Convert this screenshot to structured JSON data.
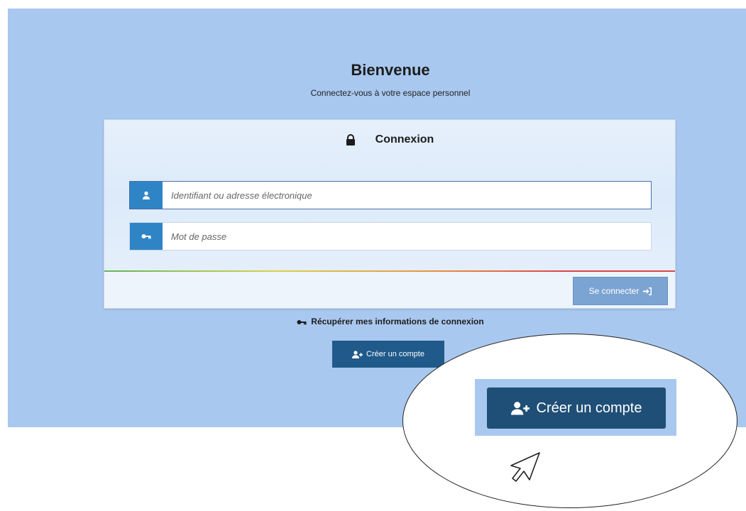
{
  "header": {
    "title": "Bienvenue",
    "subtitle": "Connectez-vous à votre espace personnel"
  },
  "login_card": {
    "heading": "Connexion",
    "heading_icon": "lock-icon",
    "username": {
      "placeholder": "Identifiant ou adresse électronique",
      "value": "",
      "icon": "user-icon"
    },
    "password": {
      "placeholder": "Mot de passe",
      "value": "",
      "icon": "key-icon"
    },
    "submit_label": "Se connecter",
    "submit_icon": "sign-in-icon"
  },
  "recover_link": {
    "label": "Récupérer mes informations de connexion",
    "icon": "key-icon"
  },
  "create_account": {
    "label": "Créer un compte",
    "icon": "user-plus-icon"
  },
  "zoom_callout": {
    "label": "Créer un compte",
    "icon": "user-plus-icon",
    "pointer": "cursor-icon"
  },
  "colors": {
    "page_bg": "#a9c8ef",
    "input_addon": "#2f84c6",
    "login_button": "#7ca4d2",
    "create_button": "#1f5a8a"
  }
}
